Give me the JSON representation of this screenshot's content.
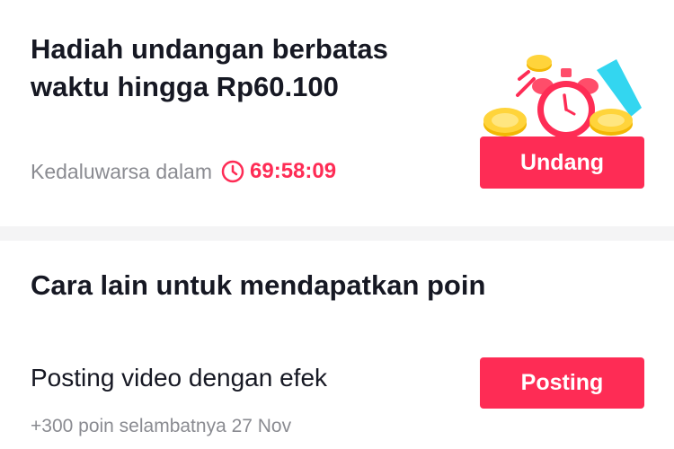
{
  "invite": {
    "title": "Hadiah undangan berbatas waktu hingga Rp60.100",
    "expiry_label": "Kedaluwarsa dalam",
    "countdown": "69:58:09",
    "button_label": "Undang"
  },
  "other_ways": {
    "title": "Cara lain untuk mendapatkan poin",
    "tasks": [
      {
        "title": "Posting video dengan efek",
        "subtitle": "+300 poin selambatnya 27 Nov",
        "button_label": "Posting"
      }
    ]
  },
  "colors": {
    "accent": "#fe2c55",
    "text_primary": "#161823",
    "text_secondary": "#8a8b91",
    "divider": "#f4f4f5"
  },
  "icons": {
    "countdown": "clock-icon",
    "illustration": "alarm-clock-coins-illustration"
  }
}
